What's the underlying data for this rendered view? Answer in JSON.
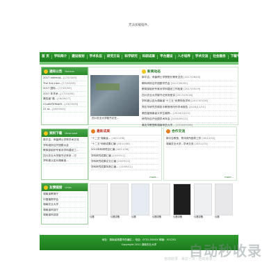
{
  "banner": {
    "message": "无法加载插件。"
  },
  "nav": [
    "首 页",
    "学科简介",
    "建设规划",
    "学术队伍",
    "研究方向",
    "科学研究",
    "科研成果",
    "平台建设",
    "人才培养",
    "学术交流",
    "社会服务",
    "下载专区"
  ],
  "notice": {
    "title": "通知公告",
    "title_en": "Notices",
    "items": [
      {
        "text": "2017 Internat...",
        "date": "[17/03/09]"
      },
      {
        "text": "The 3rd Inter...",
        "date": "[17/03/09]"
      },
      {
        "text": "2017 国际...",
        "date": "[17/03/09]"
      },
      {
        "text": "2017 年学术...",
        "date": "[17/03/09]"
      },
      {
        "text": "第四届\"湘...",
        "date": "[16/09/27]"
      },
      {
        "text": "21stINTERNATI...",
        "date": "[16/09/05]"
      },
      {
        "text": "21 st...",
        "date": "[16/09/05]"
      }
    ]
  },
  "news": {
    "title": "新闻动态",
    "photo_caption": "四川农业大学副书记在...",
    "items": [
      {
        "text": "郭平吉，来馨博士学院院长等来交流",
        "date": "[2017/06/05]"
      },
      {
        "text": "教科研所召开团委学员会",
        "date": "[2017/06/05]"
      },
      {
        "text": "教育部组织专家对学科建设工作检查",
        "date": "[2017/05/19]"
      },
      {
        "text": "四川农业大学副书记来所座谈",
        "date": "[2017/05/16]"
      },
      {
        "text": "学科被认定为湖南省\"十三五\"优势特色学科",
        "date": "[2017/03/26]"
      },
      {
        "text": "郑志华研究员和张平教授来所作学术报告",
        "date": "[2016/11/10]"
      },
      {
        "text": "第四届湖南省大学生植物...",
        "date": "[2016/10/22]"
      },
      {
        "text": "研究所召开全国学术年会",
        "date": "[2016/09/13]"
      },
      {
        "text": "黄兆华教授和湖南师范大学...",
        "date": "[2016/09/06]"
      }
    ]
  },
  "download": {
    "title": "资料下载",
    "title_en": "Download",
    "items": [
      {
        "text": "郭平吉、来馨博士学院学术交流"
      },
      {
        "text": "学科组所召开团委大会"
      },
      {
        "text": "教育部组织专家对学科建设工..."
      },
      {
        "text": "四川农业大学副书记来所...讨"
      },
      {
        "text": "学科被认定为湖南省..."
      }
    ]
  },
  "results": {
    "title": "最新成果",
    "more": "more...",
    "items": [
      {
        "text": "\"十二五\"湖南省... ",
        "date": "[16/11/08]"
      },
      {
        "text": "\"十二五\"科研成果汇编",
        "date": "[16/11/08]"
      },
      {
        "text": "2015年科研项目汇编",
        "date": "[16/11/08]"
      },
      {
        "text": "学科研究成果汇编",
        "date": "[15/09/11]"
      },
      {
        "text": "学科研究成果论文汇编",
        "date": "[15/09/11]"
      },
      {
        "text": "学科研究成果年报汇编...",
        "date": "[15/09/11]"
      }
    ]
  },
  "exchange": {
    "title": "合作交流",
    "more": "more...",
    "items": [
      {
        "text": "郭平吉教授、郑鸿来所指导工作",
        "date": "[16/12/03]"
      },
      {
        "text": "湖南农业大学...学术交流",
        "date": "[16/11/23]"
      }
    ]
  },
  "links": {
    "title": "友情链接",
    "title_en": "Links",
    "items": [
      "湖南省教育厅",
      "中国植物学会",
      "湖南农业大学",
      "湖南省科技厅",
      "湖南省科技部"
    ]
  },
  "gallery": [
    "仪器",
    "仪器设备",
    "仪器",
    "仪器设备",
    "仪器设备",
    "仪器设备",
    "仪器"
  ],
  "footer": {
    "line1": "地址：湖南省湘潭市岳塘区...  电话：0731-5XXXX  邮编：411201",
    "line2": "Copyright 2011 湖南农业大学"
  },
  "watermark": {
    "main": "自动秒收录",
    "sub": "自动收录 · 来访一次 · 自动收录"
  }
}
